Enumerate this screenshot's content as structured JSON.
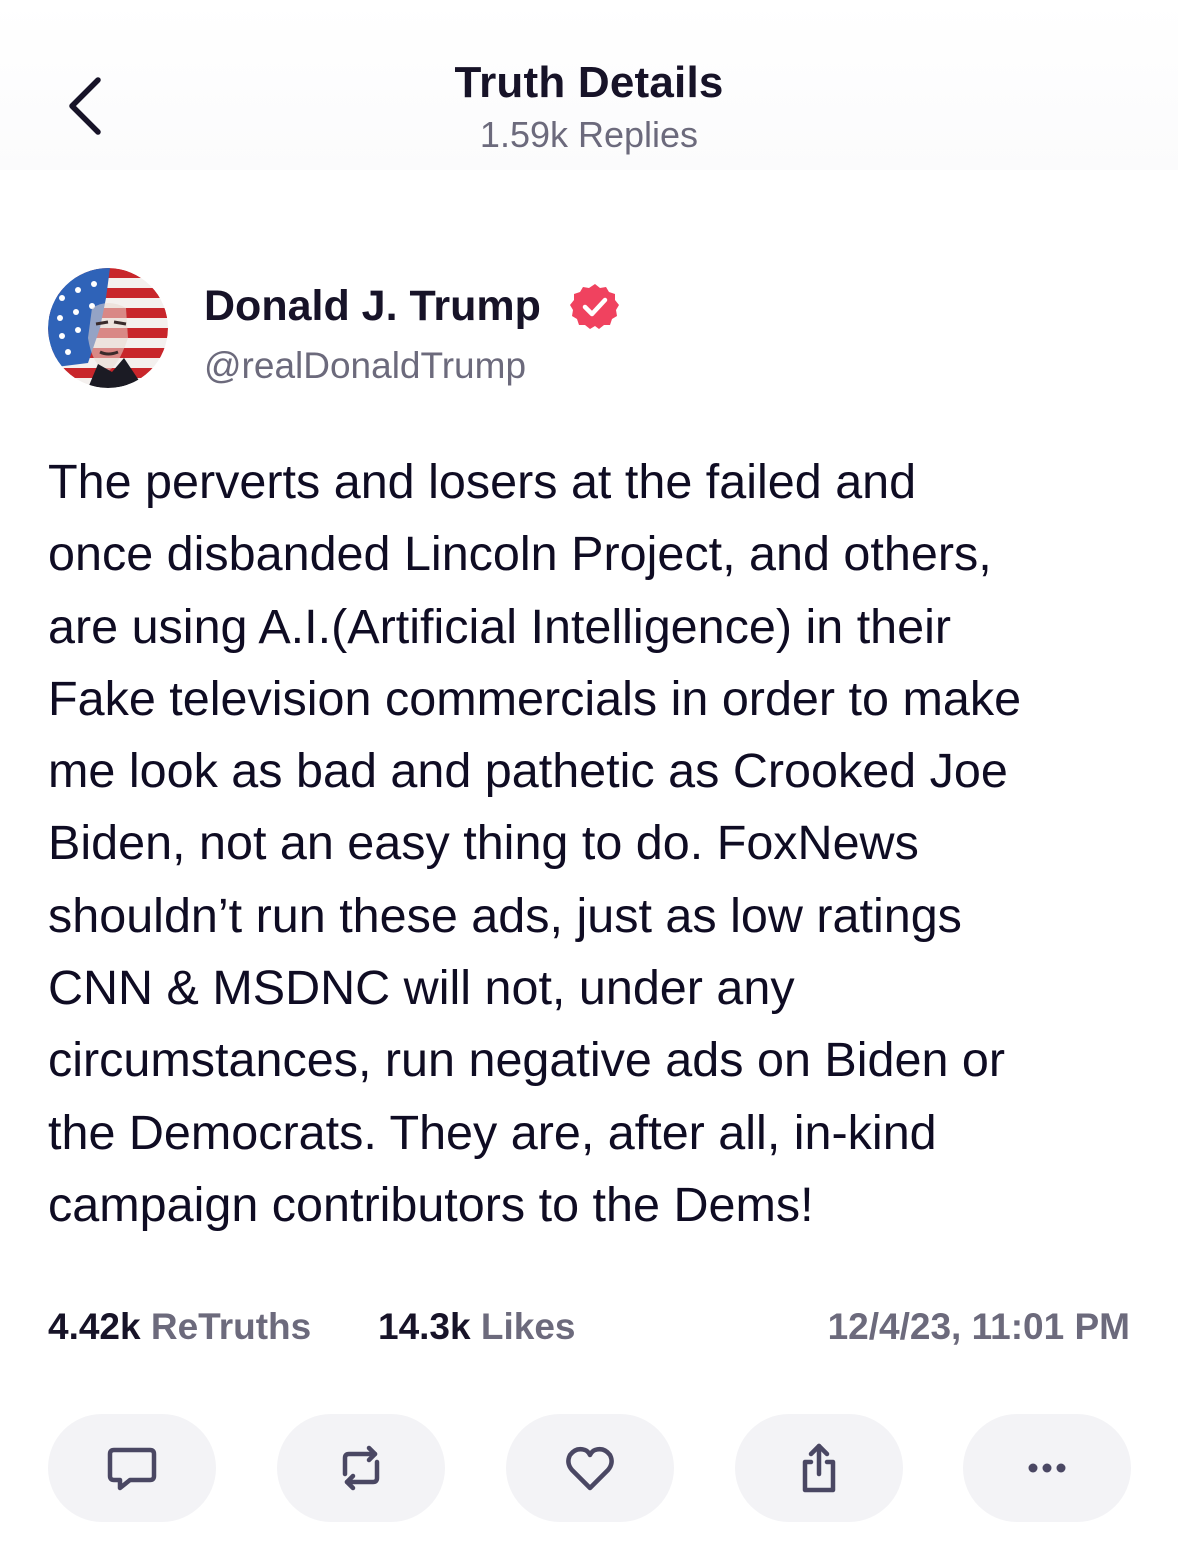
{
  "header": {
    "title": "Truth Details",
    "subtitle": "1.59k Replies"
  },
  "author": {
    "name": "Donald J. Trump",
    "handle": "@realDonaldTrump",
    "verified_color": "#f0425f"
  },
  "post": {
    "text": "The perverts and losers at the failed and\nonce disbanded Lincoln Project, and others,\nare using A.I.(Artificial Intelligence) in their\nFake television commercials in order to make\nme look as bad and pathetic as Crooked Joe\nBiden, not an easy thing to do. FoxNews\nshouldn’t run these ads, just as low ratings\nCNN & MSDNC will not, under any\ncircumstances, run negative ads on Biden or\nthe Democrats. They are, after all, in-kind\ncampaign contributors to the Dems!"
  },
  "stats": {
    "retruths_count": "4.42k",
    "retruths_label": "ReTruths",
    "likes_count": "14.3k",
    "likes_label": "Likes",
    "timestamp": "12/4/23, 11:01 PM"
  },
  "actions": [
    {
      "icon": "reply-icon"
    },
    {
      "icon": "retruth-icon"
    },
    {
      "icon": "heart-icon"
    },
    {
      "icon": "share-icon"
    },
    {
      "icon": "more-icon"
    }
  ],
  "colors": {
    "accent": "#f0425f",
    "text_primary": "#0f0c23",
    "text_secondary": "#6c6a7c",
    "button_bg": "#f3f3f6"
  }
}
